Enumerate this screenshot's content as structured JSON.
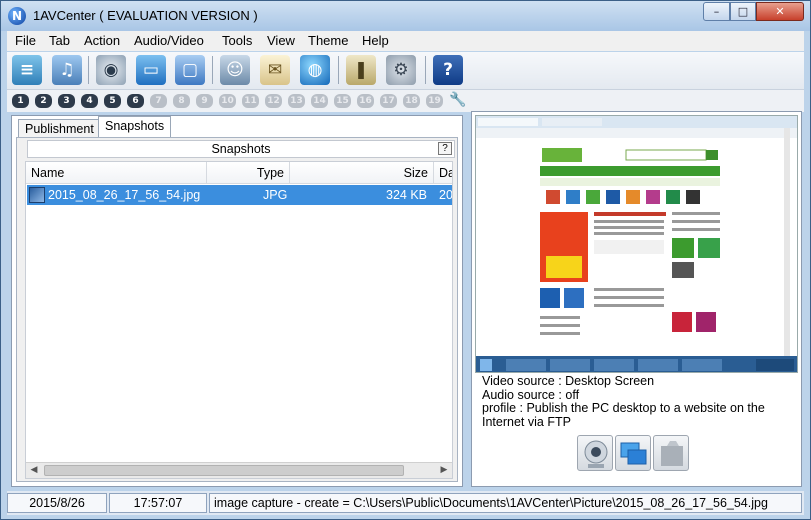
{
  "window": {
    "title": "1AVCenter ( EVALUATION VERSION )",
    "icon_letter": "N",
    "buttons": {
      "minimize": "–",
      "maximize": "□",
      "close": "✕"
    }
  },
  "menu": [
    "File",
    "Tab",
    "Action",
    "Audio/Video",
    "Tools",
    "View",
    "Theme",
    "Help"
  ],
  "toolbar": {
    "icons": [
      "broadcast-icon",
      "audio-video-icon",
      "webcam-icon",
      "desktop-screen-icon",
      "fullscreen-icon",
      "user-account-icon",
      "email-icon",
      "internet-globe-icon",
      "book-icon",
      "settings-gear-icon",
      "help-icon"
    ]
  },
  "channel_tabs": {
    "numbers": [
      "1",
      "2",
      "3",
      "4",
      "5",
      "6",
      "7",
      "8",
      "9",
      "10",
      "11",
      "12",
      "13",
      "14",
      "15",
      "16",
      "17",
      "18",
      "19"
    ],
    "enabled_count": 6
  },
  "left_tabs": {
    "publishment": "Publishment",
    "snapshots": "Snapshots"
  },
  "snapshots": {
    "header": "Snapshots",
    "help": "?",
    "columns": {
      "name": "Name",
      "type": "Type",
      "size": "Size",
      "date": "Da"
    },
    "rows": [
      {
        "name": "2015_08_26_17_56_54.jpg",
        "type": "JPG",
        "size": "324 KB",
        "date": "20"
      }
    ]
  },
  "preview_info": {
    "video_source": "Video source : Desktop Screen",
    "audio_source": "Audio source : off",
    "profile": "profile : Publish the PC desktop to a website on the Internet via FTP"
  },
  "source_buttons": [
    "webcam-source-icon",
    "desktop-source-icon",
    "file-source-icon"
  ],
  "status": {
    "date": "2015/8/26",
    "time": "17:57:07",
    "message": "image capture - create = C:\\Users\\Public\\Documents\\1AVCenter\\Picture\\2015_08_26_17_56_54.jpg"
  },
  "colors": {
    "selection": "#3b8ede",
    "title_bg": "#bcd3ea",
    "close_button": "#c7402b"
  }
}
